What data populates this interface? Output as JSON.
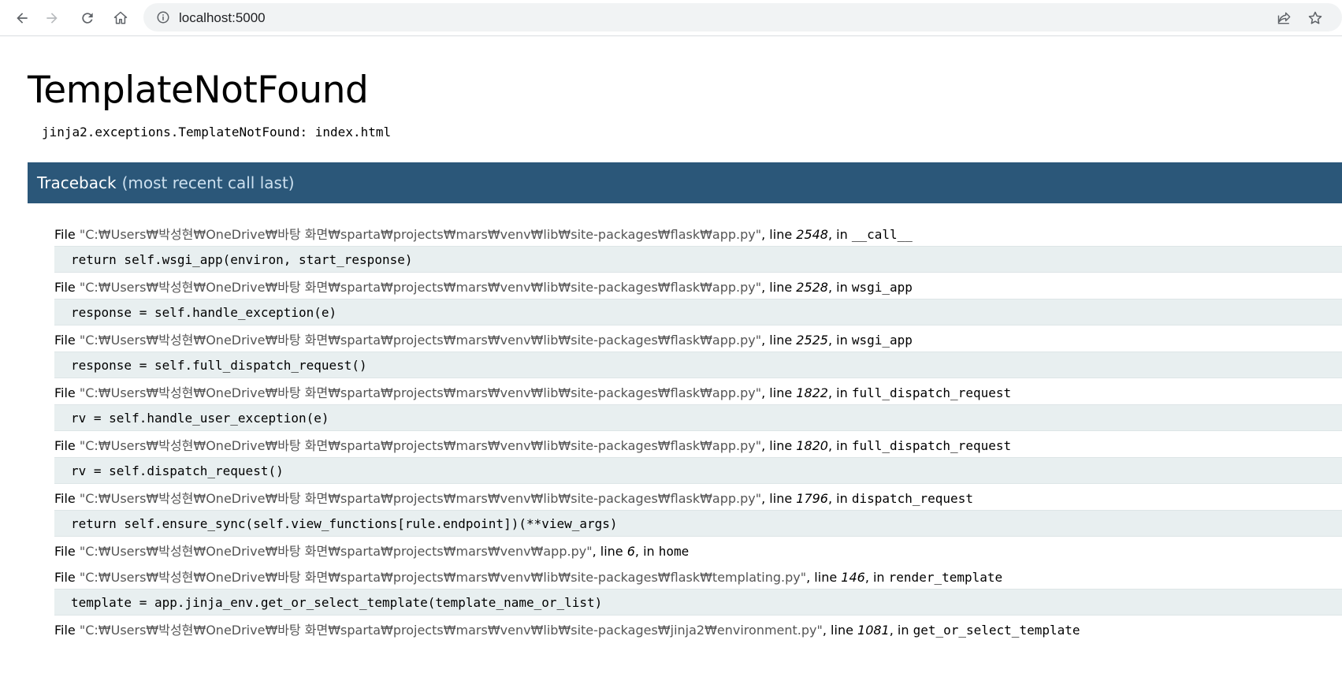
{
  "browser": {
    "url": "localhost:5000",
    "back_icon": "arrow-left",
    "forward_icon": "arrow-right",
    "reload_icon": "reload",
    "home_icon": "home",
    "info_icon": "info-circle",
    "share_icon": "share",
    "bookmark_icon": "star"
  },
  "error": {
    "title": "TemplateNotFound",
    "message": "jinja2.exceptions.TemplateNotFound: index.html"
  },
  "traceback": {
    "heading": "Traceback",
    "subheading": "(most recent call last)",
    "frames": [
      {
        "file_prefix": "File ",
        "file": "\"C:₩Users₩박성현₩OneDrive₩바탕 화면₩sparta₩projects₩mars₩venv₩lib₩site-packages₩flask₩app.py\"",
        "line_label": ", line ",
        "line": "2548",
        "in_label": ", in ",
        "func": "__call__",
        "code": "return self.wsgi_app(environ, start_response)"
      },
      {
        "file_prefix": "File ",
        "file": "\"C:₩Users₩박성현₩OneDrive₩바탕 화면₩sparta₩projects₩mars₩venv₩lib₩site-packages₩flask₩app.py\"",
        "line_label": ", line ",
        "line": "2528",
        "in_label": ", in ",
        "func": "wsgi_app",
        "code": "response = self.handle_exception(e)"
      },
      {
        "file_prefix": "File ",
        "file": "\"C:₩Users₩박성현₩OneDrive₩바탕 화면₩sparta₩projects₩mars₩venv₩lib₩site-packages₩flask₩app.py\"",
        "line_label": ", line ",
        "line": "2525",
        "in_label": ", in ",
        "func": "wsgi_app",
        "code": "response = self.full_dispatch_request()"
      },
      {
        "file_prefix": "File ",
        "file": "\"C:₩Users₩박성현₩OneDrive₩바탕 화면₩sparta₩projects₩mars₩venv₩lib₩site-packages₩flask₩app.py\"",
        "line_label": ", line ",
        "line": "1822",
        "in_label": ", in ",
        "func": "full_dispatch_request",
        "code": "rv = self.handle_user_exception(e)"
      },
      {
        "file_prefix": "File ",
        "file": "\"C:₩Users₩박성현₩OneDrive₩바탕 화면₩sparta₩projects₩mars₩venv₩lib₩site-packages₩flask₩app.py\"",
        "line_label": ", line ",
        "line": "1820",
        "in_label": ", in ",
        "func": "full_dispatch_request",
        "code": "rv = self.dispatch_request()"
      },
      {
        "file_prefix": "File ",
        "file": "\"C:₩Users₩박성현₩OneDrive₩바탕 화면₩sparta₩projects₩mars₩venv₩lib₩site-packages₩flask₩app.py\"",
        "line_label": ", line ",
        "line": "1796",
        "in_label": ", in ",
        "func": "dispatch_request",
        "code": "return self.ensure_sync(self.view_functions[rule.endpoint])(**view_args)"
      },
      {
        "file_prefix": "File ",
        "file": "\"C:₩Users₩박성현₩OneDrive₩바탕 화면₩sparta₩projects₩mars₩venv₩app.py\"",
        "line_label": ", line ",
        "line": "6",
        "in_label": ", in ",
        "func": "home",
        "code": ""
      },
      {
        "file_prefix": "File ",
        "file": "\"C:₩Users₩박성현₩OneDrive₩바탕 화면₩sparta₩projects₩mars₩venv₩lib₩site-packages₩flask₩templating.py\"",
        "line_label": ", line ",
        "line": "146",
        "in_label": ", in ",
        "func": "render_template",
        "code": "template = app.jinja_env.get_or_select_template(template_name_or_list)"
      },
      {
        "file_prefix": "File ",
        "file": "\"C:₩Users₩박성현₩OneDrive₩바탕 화면₩sparta₩projects₩mars₩venv₩lib₩site-packages₩jinja2₩environment.py\"",
        "line_label": ", line ",
        "line": "1081",
        "in_label": ", in ",
        "func": "get_or_select_template",
        "code": ""
      }
    ]
  }
}
